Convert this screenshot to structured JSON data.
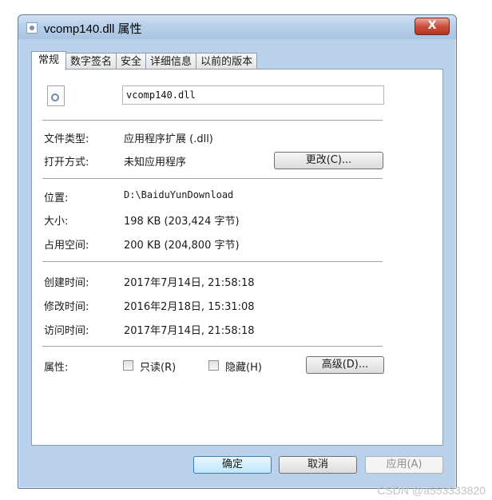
{
  "window": {
    "title": "vcomp140.dll 属性",
    "close_glyph": "X"
  },
  "tabs": [
    {
      "label": "常规",
      "active": true
    },
    {
      "label": "数字签名"
    },
    {
      "label": "安全"
    },
    {
      "label": "详细信息"
    },
    {
      "label": "以前的版本"
    }
  ],
  "general": {
    "file_name": "vcomp140.dll",
    "file_icon": "dll-gear-file-icon",
    "file_type_label": "文件类型:",
    "file_type_value": "应用程序扩展 (.dll)",
    "opens_with_label": "打开方式:",
    "opens_with_value": "未知应用程序",
    "change_button": "更改(C)...",
    "location_label": "位置:",
    "location_value": "D:\\BaiduYunDownload",
    "size_label": "大小:",
    "size_value": "198 KB (203,424 字节)",
    "size_on_disk_label": "占用空间:",
    "size_on_disk_value": "200 KB (204,800 字节)",
    "created_label": "创建时间:",
    "created_value": "2017年7月14日, 21:58:18",
    "modified_label": "修改时间:",
    "modified_value": "2016年2月18日, 15:31:08",
    "accessed_label": "访问时间:",
    "accessed_value": "2017年7月14日, 21:58:18",
    "attributes_label": "属性:",
    "readonly_label": "只读(R)",
    "readonly_checked": false,
    "hidden_label": "隐藏(H)",
    "hidden_checked": false,
    "advanced_button": "高级(D)..."
  },
  "footer": {
    "ok": "确定",
    "cancel": "取消",
    "apply": "应用(A)"
  },
  "watermark": "CSDN @a553333820"
}
